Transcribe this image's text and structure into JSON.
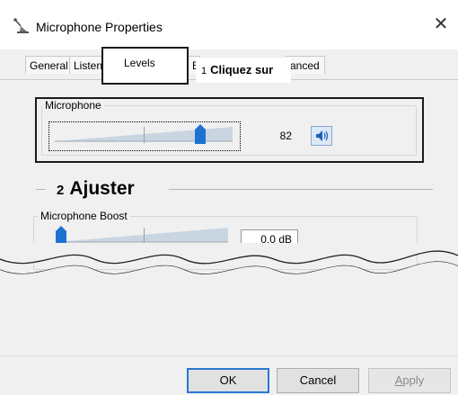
{
  "window": {
    "title": "Microphone Properties",
    "close_glyph": "✕"
  },
  "tabs": [
    {
      "label": "General"
    },
    {
      "label": "Listen"
    },
    {
      "label": "Levels"
    },
    {
      "label": "E"
    },
    {
      "label": "anced"
    }
  ],
  "callouts": {
    "step1_number": "1",
    "step1_text": "Cliquez sur",
    "step2_number": "2",
    "step2_text": "Ajuster"
  },
  "microphone_group": {
    "label": "Microphone",
    "value": "82",
    "level_fraction": 0.82,
    "speaker_icon": "speaker-volume-icon"
  },
  "boost_group": {
    "label": "Microphone Boost",
    "value": "0.0 dB",
    "level_fraction": 0.0
  },
  "buttons": {
    "ok": "OK",
    "cancel": "Cancel",
    "apply_first": "A",
    "apply_rest": "pply"
  },
  "colors": {
    "accent": "#2a77d1",
    "thumb": "#1e73d2",
    "ramp": "#c9d6e2"
  }
}
